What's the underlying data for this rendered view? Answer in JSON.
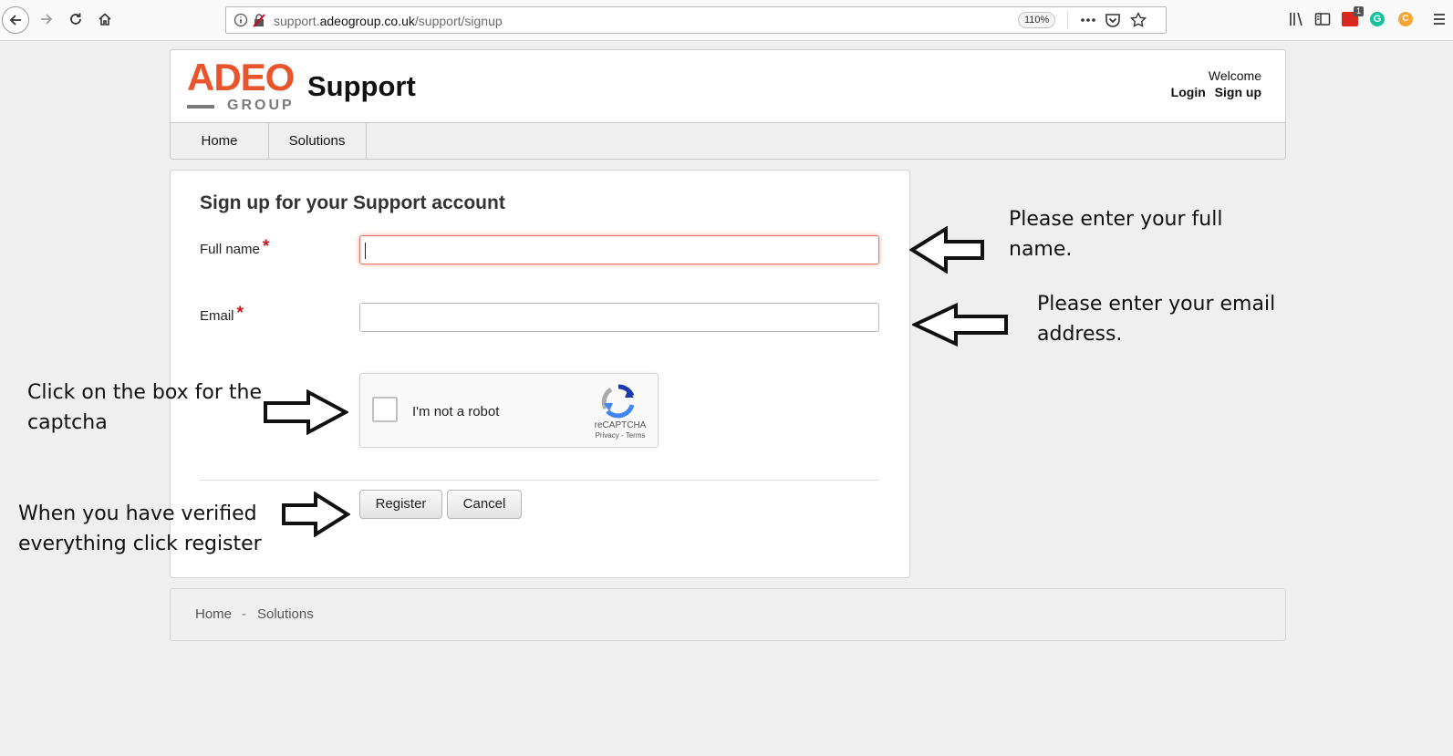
{
  "browser": {
    "url_prefix": "support.",
    "url_host": "adeogroup.co.uk",
    "url_path": "/support/signup",
    "zoom": "110%",
    "badge_count": "1"
  },
  "header": {
    "logo_text_top": "ADEO",
    "logo_text_bottom": "GROUP",
    "title": "Support",
    "welcome": "Welcome",
    "login": "Login",
    "signup": "Sign up"
  },
  "nav": {
    "items": [
      {
        "label": "Home"
      },
      {
        "label": "Solutions"
      }
    ]
  },
  "form": {
    "heading": "Sign up for your Support account",
    "full_name_label": "Full name",
    "full_name_value": "",
    "email_label": "Email",
    "email_value": "",
    "required_mark": "*",
    "captcha_label": "I'm not a robot",
    "captcha_brand": "reCAPTCHA",
    "captcha_terms": "Privacy - Terms",
    "register_label": "Register",
    "cancel_label": "Cancel"
  },
  "footer": {
    "home": "Home",
    "separator": "-",
    "solutions": "Solutions"
  },
  "annotations": {
    "full_name_1": "Please enter your full",
    "full_name_2": "name.",
    "email_1": "Please enter your email",
    "email_2": "address.",
    "captcha_1": "Click on the box for the",
    "captcha_2": "captcha",
    "register_1": "When you have verified",
    "register_2": "everything click register"
  },
  "colors": {
    "logo_orange": "#e8542c",
    "logo_gray": "#7a7a7a",
    "required_red": "#c4161c",
    "focus_red": "#e07a66"
  }
}
